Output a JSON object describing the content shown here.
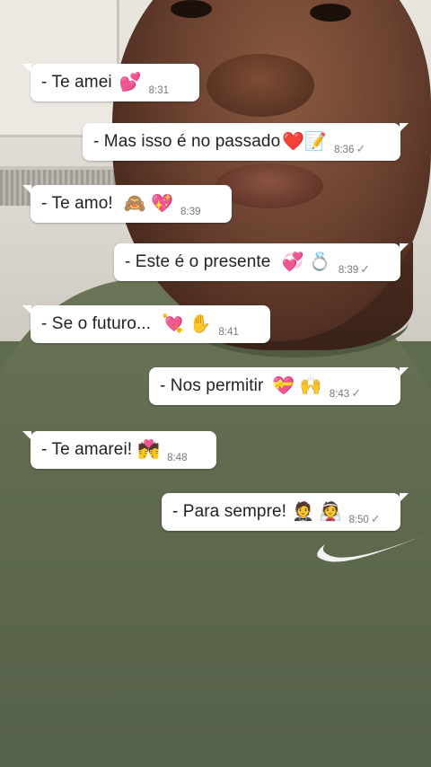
{
  "messages": [
    {
      "text": "- Te amei",
      "emoji": "💕",
      "time": "8:31",
      "direction": "in"
    },
    {
      "text": "- Mas isso é no passado",
      "emoji": "❤️📝",
      "time": "8:36",
      "direction": "out",
      "check": "✓"
    },
    {
      "text": "-  Te amo!",
      "emoji": "🙈 💖",
      "time": "8:39",
      "direction": "in"
    },
    {
      "text": "- Este é o presente",
      "emoji": "💞 💍",
      "time": "8:39",
      "direction": "out",
      "check": "✓"
    },
    {
      "text": "- Se o futuro...",
      "emoji": "💘 ✋",
      "time": "8:41",
      "direction": "in"
    },
    {
      "text": "-  Nos permitir",
      "emoji": "💝 🙌",
      "time": "8:43",
      "direction": "out",
      "check": "✓"
    },
    {
      "text": "- Te amarei!",
      "emoji": "💏",
      "time": "8:48",
      "direction": "in"
    },
    {
      "text": "- Para sempre!",
      "emoji": "🤵 👰",
      "time": "8:50",
      "direction": "out",
      "check": "✓"
    }
  ],
  "colors": {
    "bubble": "#ffffff",
    "shirt": "#5f6a4e",
    "text": "#222222",
    "time": "#777777"
  }
}
